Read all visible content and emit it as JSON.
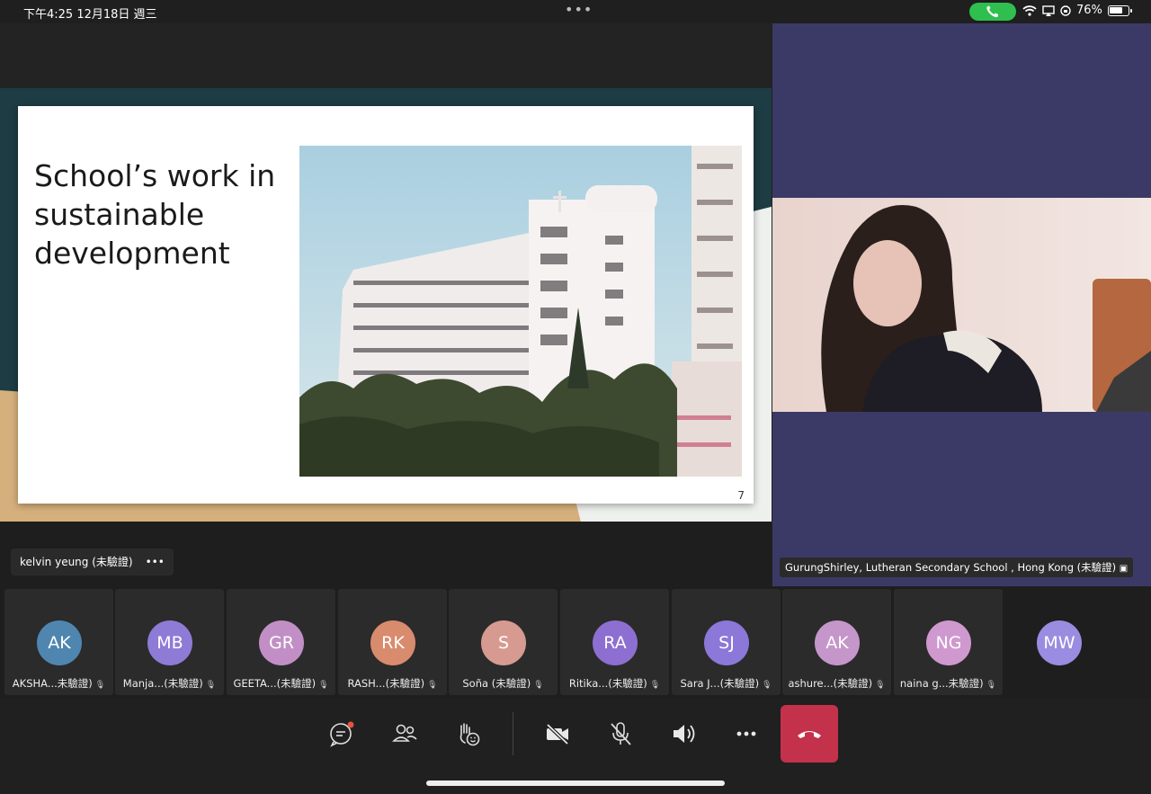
{
  "status": {
    "time": "下午4:25   12月18日 週三",
    "battery": "76%",
    "battery_level": 0.76
  },
  "slide": {
    "title": "School’s work in sustainable development",
    "page_number": "7"
  },
  "presenter": {
    "name": "kelvin yeung (未驗證)",
    "more": "•••"
  },
  "video": {
    "name": "GurungShirley, Lutheran Secondary School , Hong Kong (未驗證)"
  },
  "participants": [
    {
      "initials": "AK",
      "name": "AKSHA...未驗證)",
      "color": "#4f86b0"
    },
    {
      "initials": "MB",
      "name": "Manja...(未驗證)",
      "color": "#8e7bd6"
    },
    {
      "initials": "GR",
      "name": "GEETA...(未驗證)",
      "color": "#c18fc5"
    },
    {
      "initials": "RK",
      "name": "RASH...(未驗證)",
      "color": "#d98b6e"
    },
    {
      "initials": "S",
      "name": "Soña (未驗證)",
      "color": "#d79a90"
    },
    {
      "initials": "RA",
      "name": "Ritika...(未驗證)",
      "color": "#8d6fd1"
    },
    {
      "initials": "SJ",
      "name": "Sara J...(未驗證)",
      "color": "#8b78d9"
    },
    {
      "initials": "AK",
      "name": "ashure...(未驗證)",
      "color": "#c596c9"
    },
    {
      "initials": "NG",
      "name": "naina g...未驗證)",
      "color": "#cf98cf"
    },
    {
      "initials": "MW",
      "name": "",
      "color": "#9a8ce0"
    }
  ]
}
